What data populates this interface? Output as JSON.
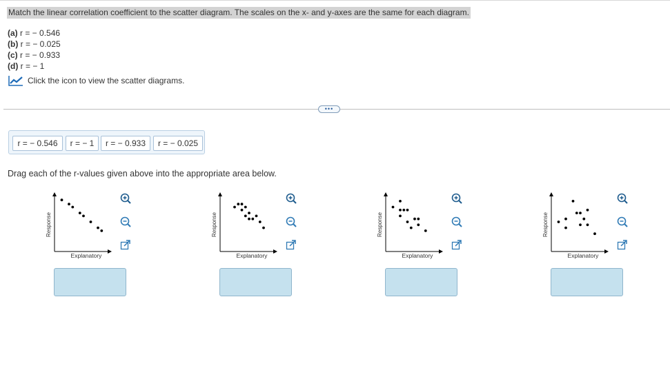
{
  "question": "Match the linear correlation coefficient to the scatter diagram. The scales on the x- and y-axes are the same for each diagram.",
  "options": [
    {
      "letter": "(a)",
      "text": " r = − 0.546"
    },
    {
      "letter": "(b)",
      "text": " r = − 0.025"
    },
    {
      "letter": "(c)",
      "text": " r = − 0.933"
    },
    {
      "letter": "(d)",
      "text": " r = − 1"
    }
  ],
  "view_prompt": "Click the icon to view the scatter diagrams.",
  "more_button": "•••",
  "chips": [
    "r = − 0.546",
    "r = − 1",
    "r = − 0.933",
    "r = − 0.025"
  ],
  "instruction": "Drag each of the r-values given above into the appropriate area below.",
  "axis_labels": {
    "y": "Response",
    "x": "Explanatory"
  },
  "accent_color": "#1e6bb8",
  "drop_zone_color": "#c5e1ee",
  "chart_data": [
    {
      "type": "scatter",
      "xlabel": "Explanatory",
      "ylabel": "Response",
      "x": [
        1,
        2,
        2.5,
        3.5,
        4,
        5,
        6,
        6.5
      ],
      "y": [
        8.7,
        8,
        7.5,
        6.5,
        6,
        5,
        4,
        3.5
      ]
    },
    {
      "type": "scatter",
      "xlabel": "Explanatory",
      "ylabel": "Response",
      "x": [
        2,
        2.5,
        3,
        3,
        3.5,
        3.5,
        4,
        4,
        4.5,
        5,
        5.5,
        6
      ],
      "y": [
        7.5,
        8,
        8,
        7,
        7.5,
        6,
        6.5,
        5.5,
        5.5,
        6,
        5,
        4
      ]
    },
    {
      "type": "scatter",
      "xlabel": "Explanatory",
      "ylabel": "Response",
      "x": [
        1,
        2,
        2,
        2,
        2.5,
        3,
        3,
        3.5,
        4,
        4.5,
        4.5,
        5.5
      ],
      "y": [
        7.5,
        8.5,
        7,
        6,
        7,
        5,
        7,
        4,
        5.5,
        5.5,
        4.5,
        3.5
      ]
    },
    {
      "type": "scatter",
      "xlabel": "Explanatory",
      "ylabel": "Response",
      "x": [
        1,
        2,
        2,
        3,
        3.5,
        4,
        4,
        4.5,
        5,
        5,
        6
      ],
      "y": [
        5,
        5.5,
        4,
        8.5,
        6.5,
        6.5,
        4.5,
        5.5,
        7,
        4.5,
        3
      ]
    }
  ]
}
